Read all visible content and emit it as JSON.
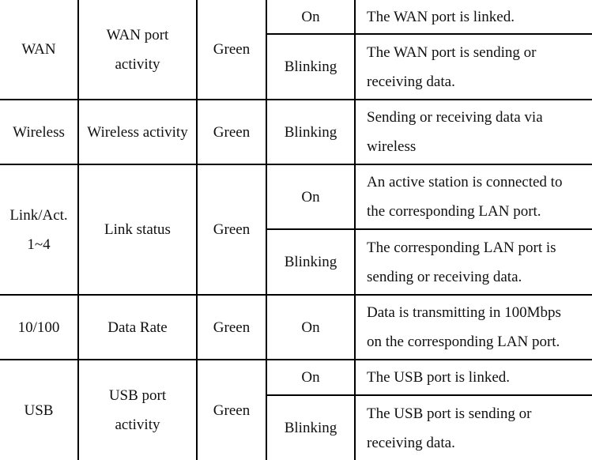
{
  "table": {
    "rows": [
      {
        "led": "WAN",
        "function": "WAN port activity",
        "function_lines": [
          "WAN port",
          "activity"
        ],
        "color": "Green",
        "states": [
          {
            "status": "On",
            "description": "The WAN port is linked.",
            "lines": [
              "The WAN port is linked."
            ]
          },
          {
            "status": "Blinking",
            "description": "The WAN port is sending or receiving data.",
            "lines": [
              "The WAN port is sending or",
              "receiving data."
            ]
          }
        ]
      },
      {
        "led": "Wireless",
        "function": "Wireless activity",
        "color": "Green",
        "states": [
          {
            "status": "Blinking",
            "description": "Sending or receiving data via wireless",
            "lines": [
              "Sending or receiving data via",
              "wireless"
            ]
          }
        ]
      },
      {
        "led": "Link/Act. 1~4",
        "led_lines": [
          "Link/Act.",
          "1~4"
        ],
        "function": "Link status",
        "color": "Green",
        "states": [
          {
            "status": "On",
            "description": "An active station is connected to the corresponding LAN port.",
            "lines": [
              "An active station is connected to",
              "the corresponding LAN port."
            ]
          },
          {
            "status": "Blinking",
            "description": "The corresponding LAN port is sending or receiving data.",
            "lines": [
              "The corresponding LAN port is",
              "sending or receiving data."
            ]
          }
        ]
      },
      {
        "led": "10/100",
        "function": "Data Rate",
        "color": "Green",
        "states": [
          {
            "status": "On",
            "description": "Data is transmitting in 100Mbps on the corresponding LAN port.",
            "lines": [
              "Data is transmitting in 100Mbps",
              "on the corresponding LAN port."
            ]
          }
        ]
      },
      {
        "led": "USB",
        "function": "USB port activity",
        "function_lines": [
          "USB port",
          "activity"
        ],
        "color": "Green",
        "states": [
          {
            "status": "On",
            "description": "The USB port is linked.",
            "lines": [
              "The USB port is linked."
            ]
          },
          {
            "status": "Blinking",
            "description": "The USB port is sending or receiving data.",
            "lines": [
              "The USB port is sending or",
              "receiving data."
            ]
          }
        ]
      }
    ]
  }
}
